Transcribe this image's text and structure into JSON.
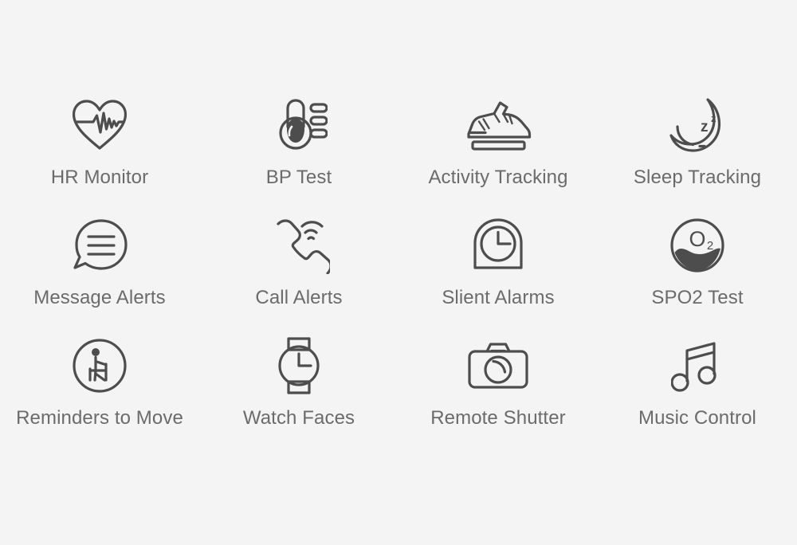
{
  "page": {
    "background_color": "#f4f4f4",
    "icon_color": "#4d4d4d",
    "label_color": "#6b6b6b",
    "columns": 4,
    "rows": 3
  },
  "features": [
    {
      "id": "hr-monitor",
      "label": "HR Monitor",
      "icon": "heart-pulse-icon"
    },
    {
      "id": "bp-test",
      "label": "BP Test",
      "icon": "blood-pressure-bulb-icon"
    },
    {
      "id": "activity-tracking",
      "label": "Activity Tracking",
      "icon": "running-shoe-icon"
    },
    {
      "id": "sleep-tracking",
      "label": "Sleep Tracking",
      "icon": "moon-zzz-icon"
    },
    {
      "id": "message-alerts",
      "label": "Message Alerts",
      "icon": "speech-bubble-lines-icon"
    },
    {
      "id": "call-alerts",
      "label": "Call Alerts",
      "icon": "phone-handset-waves-icon"
    },
    {
      "id": "slient-alarms",
      "label": "Slient Alarms",
      "icon": "arch-clock-icon"
    },
    {
      "id": "spo2-test",
      "label": "SPO2 Test",
      "icon": "oxygen-drop-circle-icon"
    },
    {
      "id": "reminders-to-move",
      "label": "Reminders to Move",
      "icon": "seated-person-circle-icon"
    },
    {
      "id": "watch-faces",
      "label": "Watch Faces",
      "icon": "wristwatch-icon"
    },
    {
      "id": "remote-shutter",
      "label": "Remote Shutter",
      "icon": "camera-icon"
    },
    {
      "id": "music-control",
      "label": "Music Control",
      "icon": "music-note-icon"
    }
  ],
  "icon_glyph_text": {
    "sleep_z_large": "z",
    "sleep_z_small": "z",
    "spo2_o": "O",
    "spo2_sub": "2"
  }
}
